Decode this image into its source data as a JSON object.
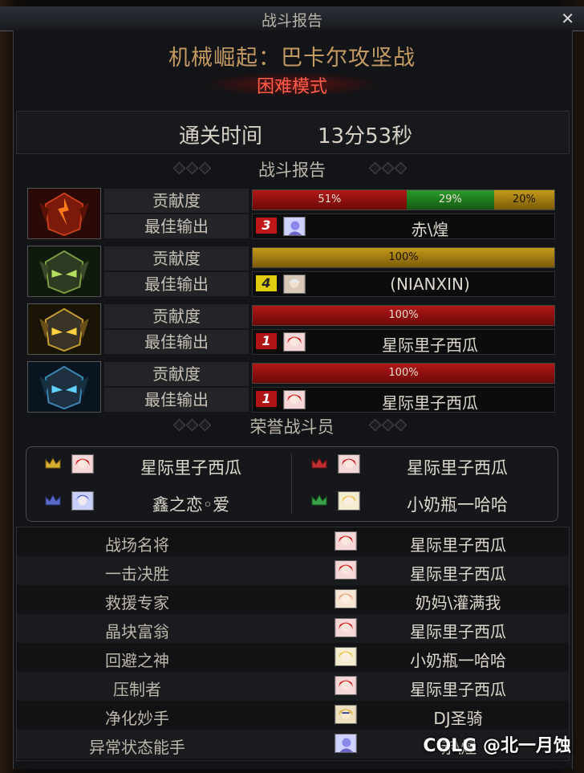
{
  "window": {
    "title": "战斗报告",
    "close": "✕"
  },
  "dungeon": {
    "name": "机械崛起：巴卡尔攻坚战",
    "mode": "困难模式"
  },
  "clear_time": {
    "label": "通关时间",
    "value": "13分53秒"
  },
  "sections": {
    "report": "战斗报告",
    "honor": "荣誉战斗员"
  },
  "row_labels": {
    "contribution": "贡献度",
    "best_output": "最佳输出"
  },
  "parties": [
    {
      "segments": [
        {
          "pct": 51,
          "text": "51%",
          "color": "red"
        },
        {
          "pct": 29,
          "text": "29%",
          "color": "green"
        },
        {
          "pct": 20,
          "text": "20%",
          "color": "gold"
        }
      ],
      "rank": "3",
      "rank_style": "r3",
      "best": "赤\\煌"
    },
    {
      "segments": [
        {
          "pct": 100,
          "text": "100%",
          "color": "gold"
        }
      ],
      "rank": "4",
      "rank_style": "r4",
      "best": "(NIANXIN)"
    },
    {
      "segments": [
        {
          "pct": 100,
          "text": "100%",
          "color": "red"
        }
      ],
      "rank": "1",
      "rank_style": "r1",
      "best": "星际里子西瓜"
    },
    {
      "segments": [
        {
          "pct": 100,
          "text": "100%",
          "color": "red"
        }
      ],
      "rank": "1",
      "rank_style": "r1",
      "best": "星际里子西瓜"
    }
  ],
  "honor": [
    {
      "name": "星际里子西瓜",
      "crown": "gold"
    },
    {
      "name": "星际里子西瓜",
      "crown": "red"
    },
    {
      "name": "鑫之恋◦爱",
      "crown": "blue"
    },
    {
      "name": "小奶瓶一哈哈",
      "crown": "green"
    }
  ],
  "awards": [
    {
      "title": "战场名将",
      "player": "星际里子西瓜"
    },
    {
      "title": "一击决胜",
      "player": "星际里子西瓜"
    },
    {
      "title": "救援专家",
      "player": "奶妈\\灌满我"
    },
    {
      "title": "晶块富翁",
      "player": "星际里子西瓜"
    },
    {
      "title": "回避之神",
      "player": "小奶瓶一哈哈"
    },
    {
      "title": "压制者",
      "player": "星际里子西瓜"
    },
    {
      "title": "净化妙手",
      "player": "DJ圣骑"
    },
    {
      "title": "异常状态能手",
      "player": "赤\\煌"
    }
  ],
  "watermark": "COLG @北一月蚀",
  "colors": {
    "red_bar": "#b01818",
    "green_bar": "#2a9a2a",
    "gold_bar": "#c49a1a",
    "mode_text": "#ff5c4a",
    "dungeon_text": "#c49a63"
  },
  "icons": {
    "portraits": [
      "fire-mech-icon",
      "green-mech-icon",
      "gold-mech-icon",
      "blue-mech-icon"
    ],
    "crown": "crown-icon",
    "avatar": "character-avatar-icon"
  }
}
